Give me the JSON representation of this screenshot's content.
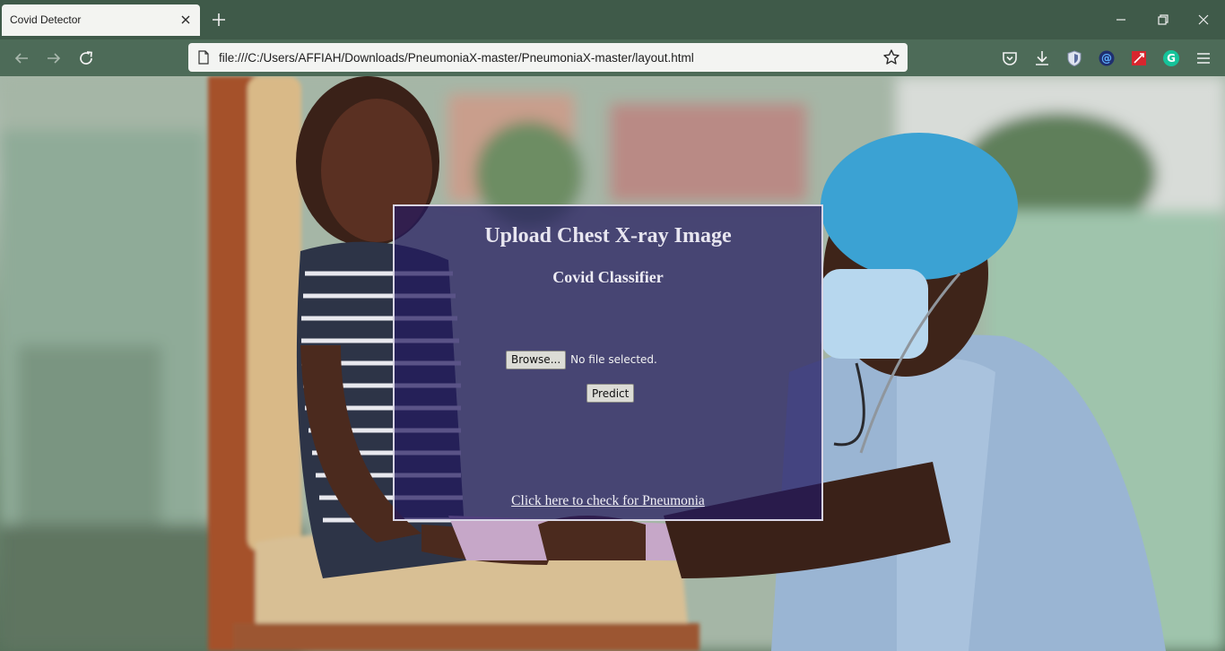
{
  "browser": {
    "tab_title": "Covid Detector",
    "url": "file:///C:/Users/AFFIAH/Downloads/PneumoniaX-master/PneumoniaX-master/layout.html"
  },
  "toolbar": {
    "icons": [
      "back-icon",
      "forward-icon",
      "reload-icon",
      "page-icon",
      "bookmark-star-icon",
      "pocket-icon",
      "download-icon",
      "shield-extension-icon",
      "at-extension-icon",
      "red-extension-icon",
      "grammarly-extension-icon",
      "menu-icon"
    ]
  },
  "card": {
    "title": "Upload Chest X-ray Image",
    "subtitle": "Covid Classifier",
    "browse_label": "Browse...",
    "file_status": "No file selected.",
    "predict_label": "Predict",
    "link_text": "Click here to check for Pneumonia"
  },
  "colors": {
    "chrome": "#3f5a49",
    "card_background": "#23195f",
    "card_border": "#d8d4e4"
  }
}
